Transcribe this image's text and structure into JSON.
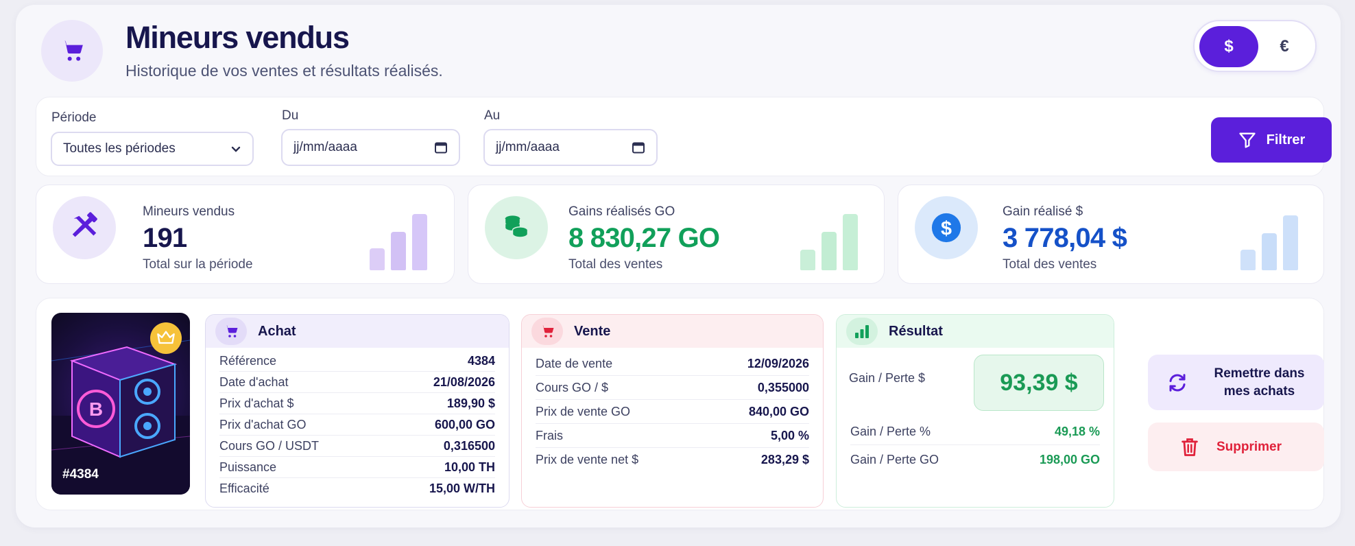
{
  "header": {
    "title": "Mineurs vendus",
    "subtitle": "Historique de vos ventes et résultats réalisés.",
    "icon": "cart-icon",
    "currency_options": [
      "$",
      "€"
    ],
    "currency_selected": "$"
  },
  "filters": {
    "period_label": "Période",
    "period_value": "Toutes les périodes",
    "from_label": "Du",
    "from_placeholder": "jj/mm/aaaa",
    "to_label": "Au",
    "to_placeholder": "jj/mm/aaaa",
    "filter_button": "Filtrer"
  },
  "stats": [
    {
      "label": "Mineurs vendus",
      "value": "191",
      "sub": "Total sur la période",
      "icon": "pickaxe-hammer-icon",
      "color": "#5b1fdb"
    },
    {
      "label": "Gains réalisés GO",
      "value": "8 830,27 GO",
      "sub": "Total des ventes",
      "icon": "coins-icon",
      "color": "#11a05a"
    },
    {
      "label": "Gain réalisé $",
      "value": "3 778,04 $",
      "sub": "Total des ventes",
      "icon": "dollar-icon",
      "color": "#1551c8"
    }
  ],
  "miner": {
    "id_label": "#4384",
    "badge_icon": "crown-icon",
    "achat": {
      "title": "Achat",
      "rows": [
        {
          "k": "Référence",
          "v": "4384"
        },
        {
          "k": "Date d'achat",
          "v": "21/08/2026"
        },
        {
          "k": "Prix d'achat $",
          "v": "189,90 $"
        },
        {
          "k": "Prix d'achat GO",
          "v": "600,00 GO"
        },
        {
          "k": "Cours GO / USDT",
          "v": "0,316500"
        },
        {
          "k": "Puissance",
          "v": "10,00 TH"
        },
        {
          "k": "Efficacité",
          "v": "15,00 W/TH"
        }
      ]
    },
    "vente": {
      "title": "Vente",
      "rows": [
        {
          "k": "Date de vente",
          "v": "12/09/2026"
        },
        {
          "k": "Cours GO / $",
          "v": "0,355000"
        },
        {
          "k": "Prix de vente GO",
          "v": "840,00 GO"
        },
        {
          "k": "Frais",
          "v": "5,00 %"
        },
        {
          "k": "Prix de vente net $",
          "v": "283,29 $"
        }
      ]
    },
    "resultat": {
      "title": "Résultat",
      "gain_usd_label": "Gain / Perte $",
      "gain_usd_value": "93,39 $",
      "gain_pct_label": "Gain / Perte %",
      "gain_pct_value": "49,18 %",
      "gain_go_label": "Gain / Perte GO",
      "gain_go_value": "198,00 GO"
    },
    "actions": {
      "restore_line1": "Remettre dans",
      "restore_line2": "mes achats",
      "delete": "Supprimer"
    }
  }
}
